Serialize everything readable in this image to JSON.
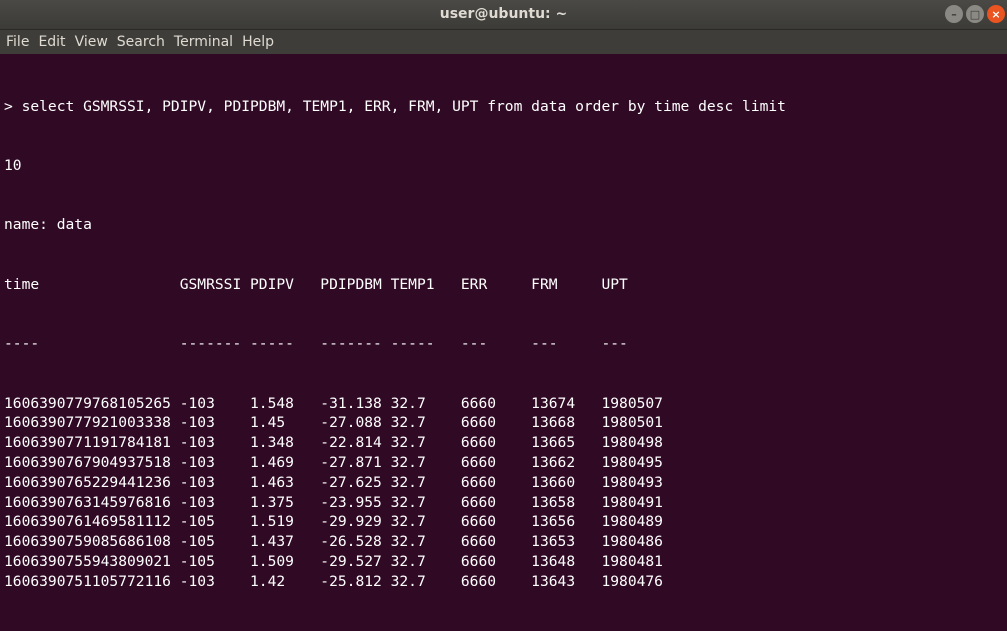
{
  "window": {
    "title": "user@ubuntu: ~",
    "controls": {
      "minimize": "–",
      "maximize": "□",
      "close": "×"
    }
  },
  "menubar": {
    "items": [
      "File",
      "Edit",
      "View",
      "Search",
      "Terminal",
      "Help"
    ]
  },
  "terminal": {
    "command_line": "> select GSMRSSI, PDIPV, PDIPDBM, TEMP1, ERR, FRM, UPT from data order by time desc limit",
    "command_wrap": "10",
    "result_name": "name: data",
    "columns": [
      "time",
      "GSMRSSI",
      "PDIPV",
      "PDIPDBM",
      "TEMP1",
      "ERR",
      "FRM",
      "UPT"
    ],
    "separators": [
      "----",
      "-------",
      "-----",
      "-------",
      "-----",
      "---",
      "---",
      "---"
    ],
    "rows": [
      [
        "1606390779768105265",
        "-103",
        "1.548",
        "-31.138",
        "32.7",
        "6660",
        "13674",
        "1980507"
      ],
      [
        "1606390777921003338",
        "-103",
        "1.45",
        "-27.088",
        "32.7",
        "6660",
        "13668",
        "1980501"
      ],
      [
        "1606390771191784181",
        "-103",
        "1.348",
        "-22.814",
        "32.7",
        "6660",
        "13665",
        "1980498"
      ],
      [
        "1606390767904937518",
        "-103",
        "1.469",
        "-27.871",
        "32.7",
        "6660",
        "13662",
        "1980495"
      ],
      [
        "1606390765229441236",
        "-103",
        "1.463",
        "-27.625",
        "32.7",
        "6660",
        "13660",
        "1980493"
      ],
      [
        "1606390763145976816",
        "-103",
        "1.375",
        "-23.955",
        "32.7",
        "6660",
        "13658",
        "1980491"
      ],
      [
        "1606390761469581112",
        "-105",
        "1.519",
        "-29.929",
        "32.7",
        "6660",
        "13656",
        "1980489"
      ],
      [
        "1606390759085686108",
        "-105",
        "1.437",
        "-26.528",
        "32.7",
        "6660",
        "13653",
        "1980486"
      ],
      [
        "1606390755943809021",
        "-105",
        "1.509",
        "-29.527",
        "32.7",
        "6660",
        "13648",
        "1980481"
      ],
      [
        "1606390751105772116",
        "-103",
        "1.42",
        "-25.812",
        "32.7",
        "6660",
        "13643",
        "1980476"
      ]
    ]
  },
  "colors": {
    "terminal_bg": "#300a24",
    "terminal_fg": "#ffffff",
    "titlebar_bg": "#3c3b37",
    "close_button": "#e95420"
  }
}
